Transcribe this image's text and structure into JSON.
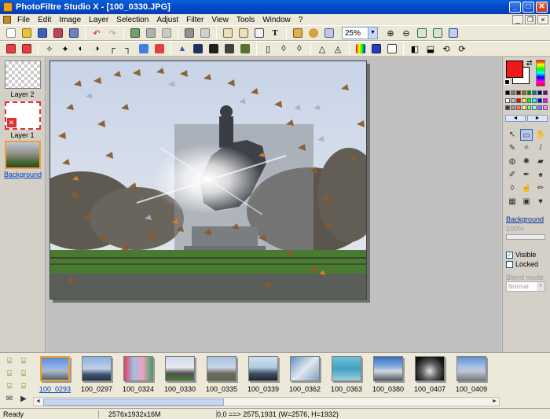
{
  "window": {
    "title": "PhotoFiltre Studio X - [100_0330.JPG]",
    "min": "_",
    "max": "□",
    "close": "✕"
  },
  "menu": [
    "File",
    "Edit",
    "Image",
    "Layer",
    "Selection",
    "Adjust",
    "Filter",
    "View",
    "Tools",
    "Window",
    "?"
  ],
  "toolbar": {
    "zoom": "25%"
  },
  "layers": [
    {
      "label": "Layer 2",
      "selected": false
    },
    {
      "label": "Layer 1",
      "selected": false
    },
    {
      "label": "Background",
      "selected": true
    }
  ],
  "properties": {
    "layer_name": "Background",
    "opacity": "100%",
    "visible_label": "Visible",
    "locked_label": "Locked",
    "blend_label": "Blend mode",
    "blend_value": "Normal"
  },
  "colors": {
    "foreground": "#f01818",
    "background": "#ffffff"
  },
  "filmstrip": [
    {
      "name": "100_0293",
      "selected": true
    },
    {
      "name": "100_0297",
      "selected": false
    },
    {
      "name": "100_0324",
      "selected": false
    },
    {
      "name": "100_0330",
      "selected": false
    },
    {
      "name": "100_0335",
      "selected": false
    },
    {
      "name": "100_0339",
      "selected": false
    },
    {
      "name": "100_0362",
      "selected": false
    },
    {
      "name": "100_0363",
      "selected": false
    },
    {
      "name": "100_0380",
      "selected": false
    },
    {
      "name": "100_0407",
      "selected": false
    },
    {
      "name": "100_0409",
      "selected": false
    }
  ],
  "status": {
    "ready": "Ready",
    "size": "2576x1932x16M",
    "coords": "0,0 ==> 2575,1931 (W=2576, H=1932)"
  }
}
